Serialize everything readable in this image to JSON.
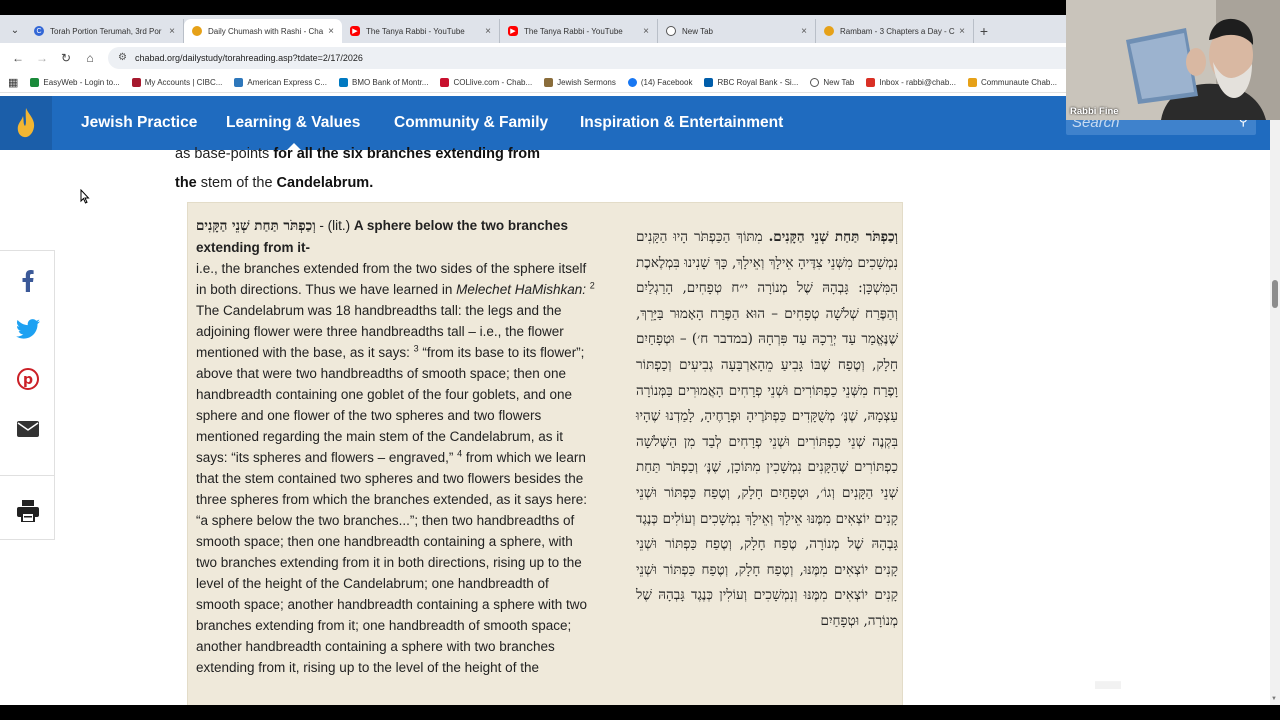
{
  "browser": {
    "tabs": [
      {
        "title": "Torah Portion Terumah, 3rd Por",
        "icon": "chabad-favicon-icon",
        "color": "#3367d6"
      },
      {
        "title": "Daily Chumash with Rashi - Cha",
        "icon": "chabad-flame-favicon-icon",
        "color": "#e6a118",
        "active": true
      },
      {
        "title": "The Tanya Rabbi - YouTube",
        "icon": "youtube-icon",
        "color": "#ff0000"
      },
      {
        "title": "The Tanya Rabbi - YouTube",
        "icon": "youtube-icon",
        "color": "#ff0000"
      },
      {
        "title": "New Tab",
        "icon": "chrome-icon",
        "color": "#555555"
      },
      {
        "title": "Rambam - 3 Chapters a Day - C",
        "icon": "chabad-flame-favicon-icon",
        "color": "#e6a118"
      }
    ],
    "url": "chabad.org/dailystudy/torahreading.asp?tdate=2/17/2026",
    "bookmarks": [
      {
        "label": "EasyWeb - Login to...",
        "color": "#1a8a3a"
      },
      {
        "label": "My Accounts | CIBC...",
        "color": "#a6192e"
      },
      {
        "label": "American Express C...",
        "color": "#2e77bb"
      },
      {
        "label": "BMO Bank of Montr...",
        "color": "#0079c1"
      },
      {
        "label": "COLlive.com - Chab...",
        "color": "#c8102e"
      },
      {
        "label": "Jewish Sermons",
        "color": "#8a6d3b"
      },
      {
        "label": "(14) Facebook",
        "color": "#1877f2"
      },
      {
        "label": "RBC Royal Bank - Si...",
        "color": "#005daa"
      },
      {
        "label": "New Tab",
        "color": "#555555"
      },
      {
        "label": "Inbox - rabbi@chab...",
        "color": "#d93025"
      },
      {
        "label": "Communaute Chab...",
        "color": "#e6a118"
      }
    ]
  },
  "site": {
    "nav": [
      "Jewish Practice",
      "Learning & Values",
      "Community & Family",
      "Inspiration & Entertainment"
    ],
    "search_placeholder": "Search",
    "brand_color": "#1f6bbf"
  },
  "intro": {
    "line1_a": "as base-points ",
    "line1_b": "for all ",
    "line1_c": "the six branches extending from",
    "line2_a": "the",
    "line2_b": " stem of the ",
    "line2_c": "Candelabrum."
  },
  "share": [
    "facebook-icon",
    "twitter-icon",
    "pinterest-icon",
    "email-icon",
    "print-icon"
  ],
  "english": {
    "heb_lemma": "וְכַפְתֹּר תַּחַת שְׁנֵי הַקָּנִים",
    "lit": " - (lit.) ",
    "lead": "A sphere below the two branches extending from it-",
    "p1": "i.e., the branches extended from the two sides of the sphere itself in both directions. Thus we have learned in ",
    "p1_italic": "Melechet HaMishkan:",
    "sup2": "2",
    "p2": " The Candelabrum was 18 handbreadths tall: the legs and the adjoining flower were three handbreadths tall – i.e., the flower mentioned with the base, as it says: ",
    "sup3": "3",
    "p3": " “from its base to its flower”; above that were two handbreadths of smooth space; then one handbreadth containing one goblet of the four goblets, and one sphere and one flower of the two spheres and two flowers mentioned regarding the main stem of the Candelabrum, as it says: “its spheres and flowers – engraved,” ",
    "sup4": "4",
    "p4": " from which we learn that the stem contained two spheres and two flowers besides the three spheres from which the branches extended, as it says here: “a sphere below the two branches...”; then two handbreadths of smooth space; then one handbreadth containing a sphere, with two branches extending from it in both directions, rising up to the level of the height of the Candelabrum; one handbreadth of smooth space; another handbreadth containing a sphere with two branches extending from it; one handbreadth of smooth space; another handbreadth containing a sphere with two branches extending from it, rising up to the level of the height of the"
  },
  "hebrew": {
    "lemma": "וְכַפְתֹּר תַּחַת שְׁנֵי הַקָּנִים.",
    "body": " מִתּוֹךְ הַכַּפְתֹּר הָיוּ הַקָּנִים נִמְשָׁכִים מִשְּׁנֵי צִדֶּיהָ אֵילָךְ וְאֵילָךְ, כָּךְ שָׁנִינוּ בִּמְלֶאכֶת הַמִּשְׁכָּן: גָּבְהָהּ שֶׁל מְנוֹרָה י״ח טְפָחִים, הָרַגְלַיִם וְהַפֶּרַח שְׁלֹשָׁה טְפָחִים – הוּא הַפֶּרַח הָאָמוּר בַּיָּרֵךְ, שֶׁנֶּאֱמַר עַד יְרֵכָהּ עַד פִּרְחָהּ (במדבר ח׳) – וּטְפָחַיִם חָלָק, וְטֶפַח שֶׁבּוֹ גָּבִיעַ מֵהָאַרְבָּעָה גְבִיעִים וְכַפְתּוֹר וָפֶרַח מִשְּׁנֵי כַפְתּוֹרִים וּשְׁנֵי פְרָחִים הָאֲמוּרִים בַּמְּנוֹרָה עַצְמָהּ, שֶׁנֶּ׳ מְשֻׁקָּדִים כַּפְתֹּרֶיהָ וּפְרָחֶיהָ, לָמַדְנוּ שֶׁהָיוּ בִּקְנֶה שְׁנֵי כַפְתּוֹרִים וּשְׁנֵי פְרָחִים לְבַד מִן הַשְּׁלֹשָׁה כַפְתּוֹרִים שֶׁהַקָּנִים נִמְשָׁכִין מִתּוֹכָן, שֶׁנֶּ׳ וְכַפְתֹּר תַּחַת שְׁנֵי הַקָּנִים וְגוֹ׳, וּטְפָחַיִם חָלָק, וְטֶפַח כַּפְתּוֹר וּשְׁנֵי קָנִים יוֹצְאִים מִמֶּנּוּ אֵילָךְ וְאֵילָךְ נִמְשָׁכִים וְעוֹלִים כְּנֶגֶד גָּבְהָהּ שֶׁל מְנוֹרָה, טֶפַח חָלָק, וְטֶפַח כַּפְתּוֹר וּשְׁנֵי קָנִים יוֹצְאִים מִמֶּנּוּ, וְטֶפַח חָלָק, וְטֶפַח כַּפְתּוֹר וּשְׁנֵי קָנִים יוֹצְאִים מִמֶּנּוּ וְנִמְשָׁכִים וְעוֹלִין כְּנֶגֶד גָּבְהָהּ שֶׁל מְנוֹרָה, וּטְפָחַיִם"
  },
  "webcam": {
    "name": "Rabbi Fine"
  }
}
